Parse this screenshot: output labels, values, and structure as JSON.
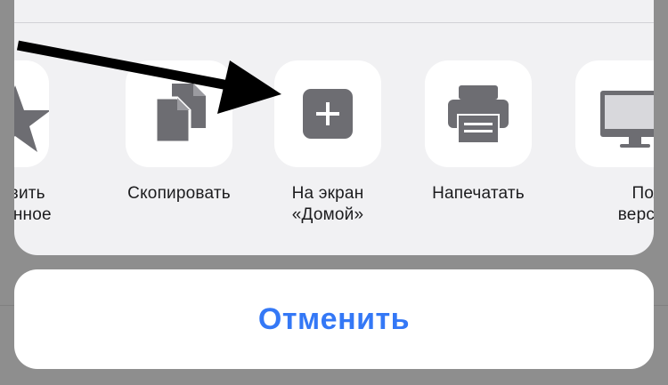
{
  "share_sheet": {
    "actions": [
      {
        "label": "бавить\nбранное",
        "icon": "star-icon"
      },
      {
        "label": "Скопировать",
        "icon": "copy-documents-icon"
      },
      {
        "label": "На экран\n«Домой»",
        "icon": "add-square-icon"
      },
      {
        "label": "Напечатать",
        "icon": "printer-icon"
      },
      {
        "label": "Полна\nверсия са",
        "icon": "desktop-monitor-icon"
      }
    ],
    "cancel_label": "Отменить"
  },
  "colors": {
    "accent": "#3478f6",
    "icon_gray": "#6d6d72",
    "sheet_bg": "#f1f1f3",
    "tile_bg": "#ffffff",
    "backdrop": "#8e8e8e"
  }
}
